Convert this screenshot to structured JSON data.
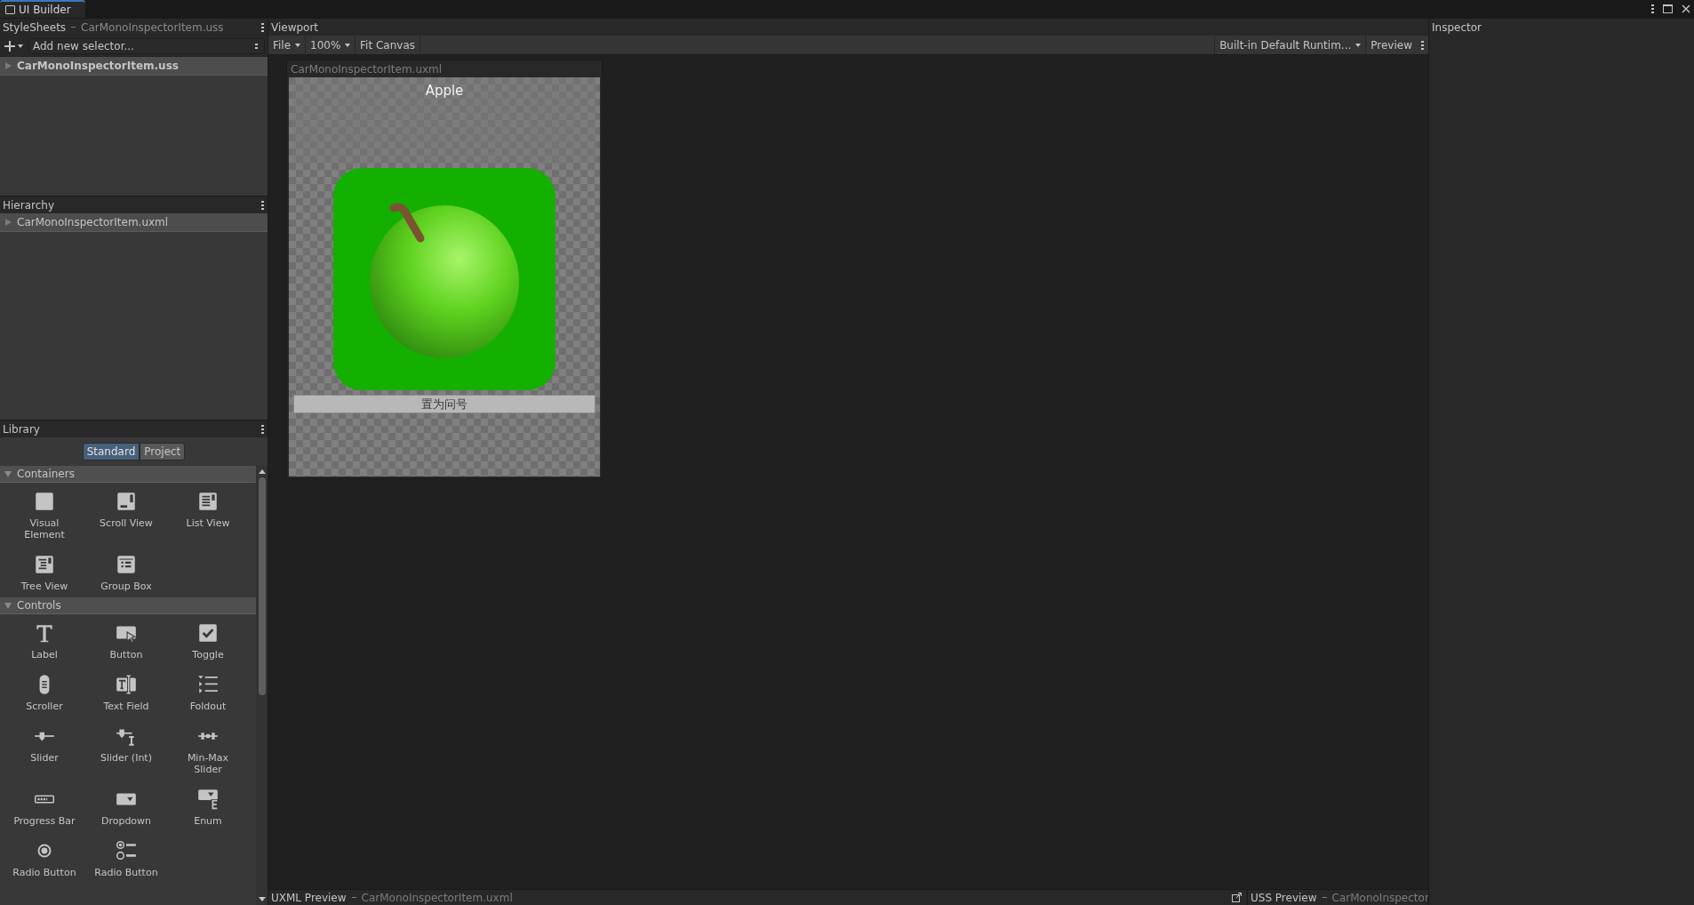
{
  "window": {
    "tab": "UI Builder"
  },
  "stylesheets": {
    "title": "StyleSheets",
    "file": "CarMonoInspectorItem.uss",
    "selector_placeholder": "Add new selector...",
    "items": [
      {
        "label": "CarMonoInspectorItem.uss",
        "expanded": false
      }
    ]
  },
  "hierarchy": {
    "title": "Hierarchy",
    "items": [
      {
        "label": "CarMonoInspectorItem.uxml",
        "expanded": false
      }
    ]
  },
  "library": {
    "title": "Library",
    "tabs": [
      {
        "label": "Standard",
        "selected": true
      },
      {
        "label": "Project",
        "selected": false
      }
    ],
    "sections": [
      {
        "title": "Containers",
        "expanded": true,
        "items": [
          {
            "label": "Visual Element",
            "kind": "visual"
          },
          {
            "label": "Scroll View",
            "kind": "scroll"
          },
          {
            "label": "List View",
            "kind": "list"
          },
          {
            "label": "Tree View",
            "kind": "tree"
          },
          {
            "label": "Group Box",
            "kind": "group"
          }
        ]
      },
      {
        "title": "Controls",
        "expanded": true,
        "items": [
          {
            "label": "Label",
            "kind": "label"
          },
          {
            "label": "Button",
            "kind": "button"
          },
          {
            "label": "Toggle",
            "kind": "toggle"
          },
          {
            "label": "Scroller",
            "kind": "scroller"
          },
          {
            "label": "Text Field",
            "kind": "textfield"
          },
          {
            "label": "Foldout",
            "kind": "foldout"
          },
          {
            "label": "Slider",
            "kind": "slider"
          },
          {
            "label": "Slider (Int)",
            "kind": "sliderint"
          },
          {
            "label": "Min-Max Slider",
            "kind": "minmax"
          },
          {
            "label": "Progress Bar",
            "kind": "progress"
          },
          {
            "label": "Dropdown",
            "kind": "dropdown"
          },
          {
            "label": "Enum",
            "kind": "enum"
          },
          {
            "label": "Radio Button",
            "kind": "radio"
          },
          {
            "label": "Radio Button",
            "kind": "radiogroup"
          }
        ]
      }
    ]
  },
  "viewport": {
    "title": "Viewport",
    "toolbar": {
      "file_menu": "File",
      "zoom": "100%",
      "fit": "Fit Canvas",
      "theme": "Built-in Default Runtim...",
      "preview": "Preview"
    },
    "canvas": {
      "file": "CarMonoInspectorItem.uxml",
      "label": "Apple",
      "button": "置为问号"
    }
  },
  "inspector": {
    "title": "Inspector"
  },
  "bottom": {
    "uxml_preview": {
      "title": "UXML Preview",
      "file": "CarMonoInspectorItem.uxml"
    },
    "uss_preview": {
      "title": "USS Preview",
      "file": "CarMonoInspector"
    }
  }
}
